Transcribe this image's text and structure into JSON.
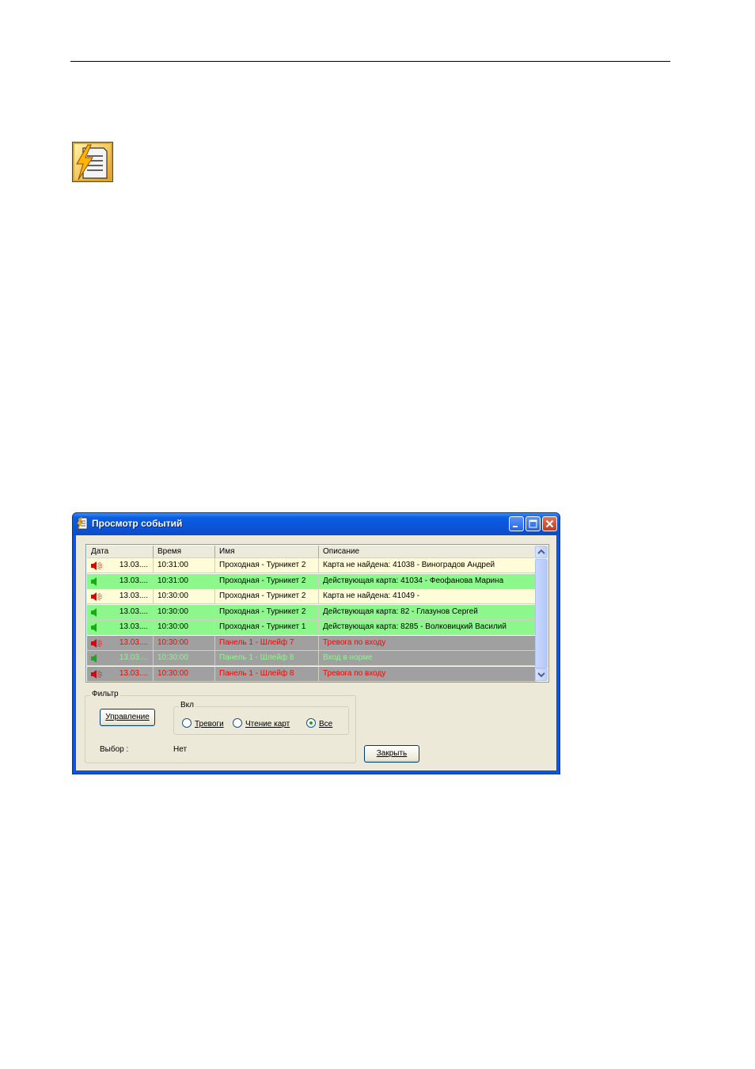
{
  "window": {
    "title": "Просмотр событий"
  },
  "grid": {
    "columns": [
      "Дата",
      "Время",
      "Имя",
      "Описание"
    ],
    "rows": [
      {
        "date": "13.03....",
        "time": "10:31:00",
        "name": "Проходная - Турникет 2",
        "desc": "Карта не найдена: 41038 - Виноградов Андрей",
        "bg": "#fffcd8",
        "fg": "#000000",
        "icon": "speaker-alarm-icon"
      },
      {
        "date": "13.03....",
        "time": "10:31:00",
        "name": "Проходная - Турникет 2",
        "desc": "Действующая карта: 41034 - Феофанова Марина",
        "bg": "#8cf88c",
        "fg": "#000000",
        "icon": "speaker-ok-icon"
      },
      {
        "date": "13.03....",
        "time": "10:30:00",
        "name": "Проходная - Турникет 2",
        "desc": "Карта не найдена: 41049 -",
        "bg": "#fffcd8",
        "fg": "#000000",
        "icon": "speaker-alarm-icon"
      },
      {
        "date": "13.03....",
        "time": "10:30:00",
        "name": "Проходная - Турникет 2",
        "desc": "Действующая карта: 82 - Глазунов Сергей",
        "bg": "#8cf88c",
        "fg": "#000000",
        "icon": "speaker-ok-icon"
      },
      {
        "date": "13.03....",
        "time": "10:30:00",
        "name": "Проходная - Турникет 1",
        "desc": "Действующая карта: 8285 - Волковицкий Василий",
        "bg": "#8cf88c",
        "fg": "#000000",
        "icon": "speaker-ok-icon"
      },
      {
        "date": "13.03....",
        "time": "10:30:00",
        "name": "Панель 1 - Шлейф 7",
        "desc": "Тревога по входу",
        "bg": "#a0a0a0",
        "fg": "#ff0000",
        "icon": "speaker-alarm-icon"
      },
      {
        "date": "13.03....",
        "time": "10:30:00",
        "name": "Панель 1 - Шлейф 8",
        "desc": "Вход в норме",
        "bg": "#a0a0a0",
        "fg": "#8cf88c",
        "icon": "speaker-ok-icon"
      },
      {
        "date": "13.03....",
        "time": "10:30:00",
        "name": "Панель 1 - Шлейф 8",
        "desc": "Тревога по входу",
        "bg": "#a0a0a0",
        "fg": "#ff0000",
        "icon": "speaker-alarm-icon"
      }
    ]
  },
  "filter": {
    "group_label": "Фильтр",
    "control_button": "Управление",
    "enabled_group_label": "Вкл",
    "radios": [
      {
        "label": "Тревоги",
        "checked": false
      },
      {
        "label": "Чтение карт",
        "checked": false
      },
      {
        "label": "Все",
        "checked": true
      }
    ],
    "selection_label": "Выбор :",
    "selection_value": "Нет"
  },
  "close_button": "Закрыть",
  "colors": {
    "titlebar": "#0a54e3",
    "window_bg": "#ece9d8",
    "row_alarm_card": "#fffcd8",
    "row_valid_card": "#8cf88c",
    "row_panel": "#a0a0a0",
    "text_alarm": "#ff0000"
  }
}
